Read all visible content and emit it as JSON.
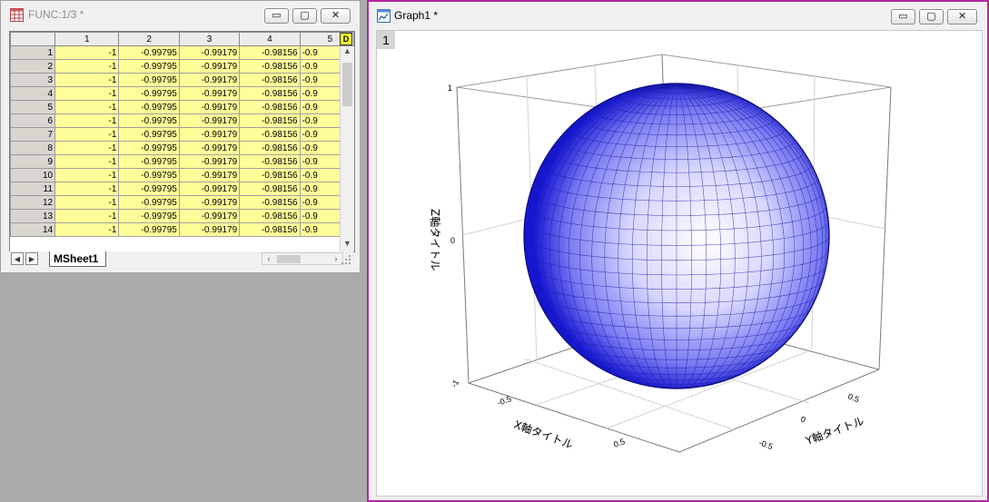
{
  "worksheet_window": {
    "title": "FUNC:1/3  *",
    "buttons": {
      "minimize": "▭",
      "maximize": "▢",
      "close": "✕"
    },
    "columns": [
      "1",
      "2",
      "3",
      "4",
      "5"
    ],
    "rows": [
      {
        "n": "1",
        "cells": [
          "-1",
          "-0.99795",
          "-0.99179",
          "-0.98156",
          "-0.9"
        ]
      },
      {
        "n": "2",
        "cells": [
          "-1",
          "-0.99795",
          "-0.99179",
          "-0.98156",
          "-0.9"
        ]
      },
      {
        "n": "3",
        "cells": [
          "-1",
          "-0.99795",
          "-0.99179",
          "-0.98156",
          "-0.9"
        ]
      },
      {
        "n": "4",
        "cells": [
          "-1",
          "-0.99795",
          "-0.99179",
          "-0.98156",
          "-0.9"
        ]
      },
      {
        "n": "5",
        "cells": [
          "-1",
          "-0.99795",
          "-0.99179",
          "-0.98156",
          "-0.9"
        ]
      },
      {
        "n": "6",
        "cells": [
          "-1",
          "-0.99795",
          "-0.99179",
          "-0.98156",
          "-0.9"
        ]
      },
      {
        "n": "7",
        "cells": [
          "-1",
          "-0.99795",
          "-0.99179",
          "-0.98156",
          "-0.9"
        ]
      },
      {
        "n": "8",
        "cells": [
          "-1",
          "-0.99795",
          "-0.99179",
          "-0.98156",
          "-0.9"
        ]
      },
      {
        "n": "9",
        "cells": [
          "-1",
          "-0.99795",
          "-0.99179",
          "-0.98156",
          "-0.9"
        ]
      },
      {
        "n": "10",
        "cells": [
          "-1",
          "-0.99795",
          "-0.99179",
          "-0.98156",
          "-0.9"
        ]
      },
      {
        "n": "11",
        "cells": [
          "-1",
          "-0.99795",
          "-0.99179",
          "-0.98156",
          "-0.9"
        ]
      },
      {
        "n": "12",
        "cells": [
          "-1",
          "-0.99795",
          "-0.99179",
          "-0.98156",
          "-0.9"
        ]
      },
      {
        "n": "13",
        "cells": [
          "-1",
          "-0.99795",
          "-0.99179",
          "-0.98156",
          "-0.9"
        ]
      },
      {
        "n": "14",
        "cells": [
          "-1",
          "-0.99795",
          "-0.99179",
          "-0.98156",
          "-0.9"
        ]
      }
    ],
    "sheet_tab": "MSheet1",
    "d_button": "D"
  },
  "graph_window": {
    "title": "Graph1 *",
    "layer_label": "1",
    "buttons": {
      "minimize": "▭",
      "maximize": "▢",
      "close": "✕"
    }
  },
  "chart_data": {
    "type": "surface3d",
    "surface": "sphere",
    "radius": 1,
    "zlabel": "Z軸タイトル",
    "xlabel": "X軸タイトル",
    "ylabel": "Y軸タイトル",
    "z_ticks": [
      "1",
      "0",
      "-1"
    ],
    "x_ticks": [
      "-0.5",
      "0.5"
    ],
    "y_ticks": [
      "0.5",
      "0",
      "-0.5"
    ],
    "grid": true,
    "colors": {
      "surface_dark": "#0000c8",
      "surface_light": "#ffffff",
      "mesh": "#1a1aa8"
    }
  }
}
